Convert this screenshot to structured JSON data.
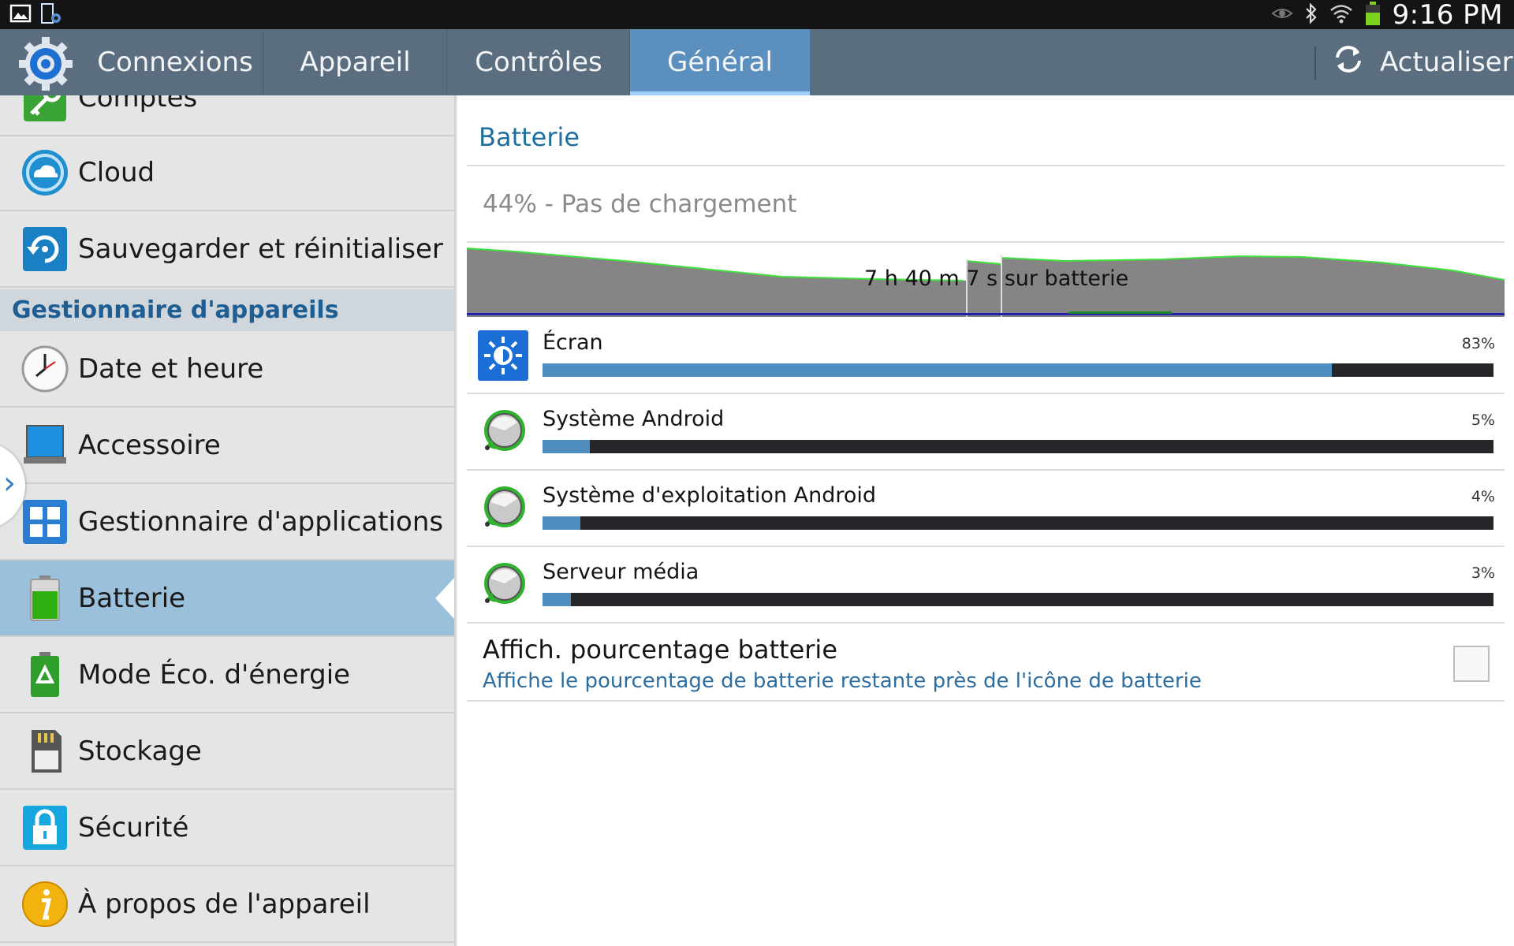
{
  "status_bar": {
    "time": "9:16 PM",
    "icons": [
      "gallery-icon",
      "settings-notification-icon",
      "eye-icon",
      "bluetooth-icon",
      "wifi-icon",
      "battery-icon"
    ],
    "battery_color": "#7ed321"
  },
  "tabs": [
    {
      "label": "Connexions",
      "active": false
    },
    {
      "label": "Appareil",
      "active": false
    },
    {
      "label": "Contrôles",
      "active": false
    },
    {
      "label": "Général",
      "active": true
    }
  ],
  "refresh_label": "Actualiser",
  "sidebar": {
    "items": [
      {
        "label": "Comptes",
        "icon": "key-icon"
      },
      {
        "label": "Cloud",
        "icon": "cloud-icon"
      },
      {
        "label": "Sauvegarder et réinitialiser",
        "icon": "backup-reset-icon"
      },
      {
        "label": "Date et heure",
        "icon": "clock-icon"
      },
      {
        "label": "Accessoire",
        "icon": "accessory-icon"
      },
      {
        "label": "Gestionnaire d'applications",
        "icon": "apps-grid-icon"
      },
      {
        "label": "Batterie",
        "icon": "battery-icon",
        "selected": true
      },
      {
        "label": "Mode Éco. d'énergie",
        "icon": "power-saving-icon"
      },
      {
        "label": "Stockage",
        "icon": "sd-card-icon"
      },
      {
        "label": "Sécurité",
        "icon": "lock-icon"
      },
      {
        "label": "À propos de l'appareil",
        "icon": "info-icon"
      }
    ],
    "section_header": "Gestionnaire d'appareils"
  },
  "main": {
    "section_title": "Batterie",
    "status": "44% - Pas de chargement",
    "graph_label": "7 h 40 m 7 s sur batterie",
    "usage": [
      {
        "name": "Écran",
        "percent_label": "83%",
        "percent": 83,
        "icon": "display-brightness-icon"
      },
      {
        "name": "Système Android",
        "percent_label": "5%",
        "percent": 5,
        "icon": "android-system-icon"
      },
      {
        "name": "Système d'exploitation Android",
        "percent_label": "4%",
        "percent": 4,
        "icon": "android-os-icon"
      },
      {
        "name": "Serveur média",
        "percent_label": "3%",
        "percent": 3,
        "icon": "media-server-icon"
      }
    ],
    "pct_setting": {
      "title": "Affich. pourcentage batterie",
      "description": "Affiche le pourcentage de batterie restante près de l'icône de batterie",
      "checked": false
    }
  },
  "colors": {
    "tab_bar": "#5b6e80",
    "tab_active": "#5a8fbe",
    "accent_text": "#1e6e9e",
    "usage_fill": "#4f8fc0",
    "graph_line": "#3de23d"
  }
}
